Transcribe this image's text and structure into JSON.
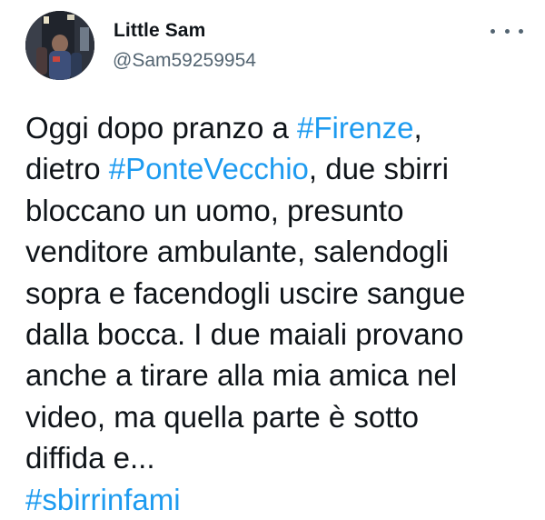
{
  "author": {
    "display_name": "Little Sam",
    "handle": "@Sam59259954",
    "avatar_icon": "profile-photo"
  },
  "more_menu": {
    "icon": "more-horizontal-icon"
  },
  "tweet": {
    "line1_before": "Oggi dopo pranzo a ",
    "hashtag_firenze": "#Firenze",
    "line1_after": ",",
    "line2_before": "dietro ",
    "hashtag_pontevecchio": "#PonteVecchio",
    "line2_after": ", due sbirri",
    "line3": "bloccano un uomo, presunto",
    "line4": "venditore ambulante, salendogli",
    "line5": "sopra e facendogli uscire sangue",
    "line6": "dalla bocca. I due maiali provano",
    "line7": "anche a tirare alla mia amica nel",
    "line8": "video, ma quella parte è sotto",
    "line9": "diffida e...",
    "hashtag_sbirrinfami": "#sbirrinfami"
  },
  "colors": {
    "hashtag": "#1d9bf0",
    "text": "#0f1419",
    "secondary": "#536471"
  }
}
